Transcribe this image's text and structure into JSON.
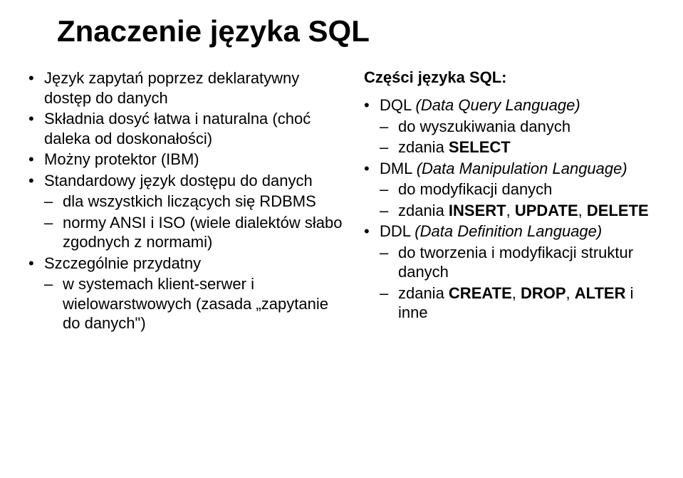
{
  "title": "Znaczenie języka SQL",
  "left": {
    "items": [
      {
        "text": "Język zapytań poprzez deklaratywny dostęp do danych"
      },
      {
        "text": "Składnia dosyć łatwa i naturalna (choć daleka od doskonałości)"
      },
      {
        "text": "Możny protektor (IBM)"
      },
      {
        "text": "Standardowy język dostępu do danych",
        "sub": [
          "dla wszystkich liczących się RDBMS",
          "normy ANSI i ISO (wiele dialektów słabo zgodnych z normami)"
        ]
      },
      {
        "text": "Szczególnie przydatny",
        "sub": [
          "w systemach klient-serwer i wielowarstwowych (zasada „zapytanie do danych\")"
        ]
      }
    ]
  },
  "right": {
    "heading": "Części języka SQL:",
    "items": [
      {
        "prefix": "DQL ",
        "italic": "(Data Query Language)",
        "sub": [
          {
            "text": "do wyszukiwania danych"
          },
          {
            "text_pre": "zdania ",
            "bold": "SELECT"
          }
        ]
      },
      {
        "prefix": "DML ",
        "italic": "(Data Manipulation Language)",
        "sub": [
          {
            "text": "do modyfikacji danych"
          },
          {
            "text_pre": "zdania ",
            "bold": "INSERT",
            "text_mid": ", ",
            "bold2": "UPDATE",
            "text_mid2": ", ",
            "bold3": "DELETE"
          }
        ]
      },
      {
        "prefix": "DDL ",
        "italic": "(Data Definition Language)",
        "sub": [
          {
            "text": "do tworzenia i modyfikacji struktur danych"
          },
          {
            "text_pre": "zdania ",
            "bold": "CREATE",
            "text_mid": ", ",
            "bold2": "DROP",
            "text_mid2": ", ",
            "bold3": "ALTER",
            "text_post": " i inne"
          }
        ]
      }
    ]
  }
}
